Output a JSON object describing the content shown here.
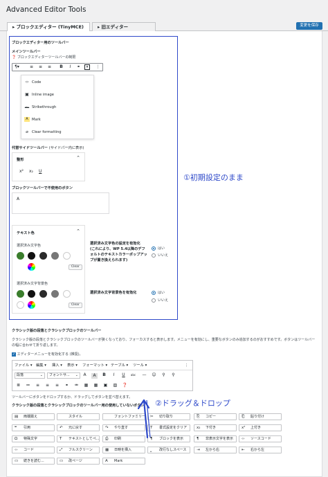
{
  "page_title": "Advanced Editor Tools",
  "save_button": "変更を保存",
  "tabs": [
    {
      "label": "ブロックエディター (TinyMCE)",
      "prefix": "▸"
    },
    {
      "label": "旧エディター (TinyMCE)",
      "prefix": "▸"
    }
  ],
  "block": {
    "section_title": "ブロックエディター用のツールバー",
    "main_toolbar_label": "メインツールバー",
    "main_toolbar_hint": "ブロックエディターツールバーの制限",
    "dropdown_items": [
      {
        "icon": "code-icon",
        "glyph": "‹›",
        "label": "Code"
      },
      {
        "icon": "image-icon",
        "glyph": "▣",
        "label": "Inline image"
      },
      {
        "icon": "strikethrough-icon",
        "glyph": "abc",
        "label": "Strikethrough"
      },
      {
        "icon": "mark-icon",
        "glyph": "A",
        "label": "Mark"
      },
      {
        "icon": "clear-format-icon",
        "glyph": "⌀",
        "label": "Clear formatting"
      }
    ],
    "side_toolbar_label": "代替サイドツールバー",
    "side_toolbar_note": "(サイドパー内に表示)",
    "format_panel_title": "整形",
    "format_icons": [
      "x²",
      "x₂",
      "U"
    ],
    "unused_label": "ブロックツールバーで不使用のボタン",
    "unused_box_value": "A",
    "text_color_panel_title": "テキスト色",
    "selected_text_color_label": "選択済み文字色",
    "selected_bg_color_label": "選択済み文字背景色",
    "clear_label": "Clear",
    "enable_text_color_label": "選択済み文字色の設定を有効化",
    "enable_text_color_desc": "(これにより、WP 5.4以降のデフォルトのテキストカラーポップアップが置き換えられます)",
    "enable_bg_color_label": "選択済み文字背景色を有効化",
    "yes": "はい",
    "no": "いいえ"
  },
  "annotation_1": "①初期設定のまま",
  "annotation_2": "②ドラッグ＆ドロップ",
  "classic": {
    "section_title": "クラシック版の段落とクラシックブロックのツールバー",
    "description": "クラシック版の段落とクラシックブロックのツールバーが狭くなっており、フォーカスすると表示します。メニューを有効にし、重要なボタンのみ追加するのがおすすめです。ボタンはツールバーの幅に合わせて折り返します。",
    "enable_menu_label": "エディターメニューを有効化する (推奨)。",
    "menu_items": [
      "ファイル ▾",
      "編集 ▾",
      "挿入 ▾",
      "表示 ▾",
      "フォーマット ▾",
      "テーブル ▾",
      "ツール ▾"
    ],
    "format_select": "段落",
    "font_select": "フォントサ...",
    "drag_hint": "ツールバーにボタンをドロップするか、ドラッグしてボタンを並べ替えます。",
    "unused_title": "クラシック版の段落とクラシックブロックのツールバー用の使用していないボタン",
    "unused_buttons": [
      {
        "icon": "paragraph-icon",
        "glyph": "▤",
        "label": "両端揃え"
      },
      {
        "icon": "style-icon",
        "glyph": "",
        "label": "スタイル"
      },
      {
        "icon": "font-family-icon",
        "glyph": "",
        "label": "フォントファミリー"
      },
      {
        "icon": "cut-icon",
        "glyph": "✂",
        "label": "切り取り"
      },
      {
        "icon": "copy-icon",
        "glyph": "⎘",
        "label": "コピー"
      },
      {
        "icon": "paste-icon",
        "glyph": "⎗",
        "label": "貼り付け"
      },
      {
        "icon": "quote-icon",
        "glyph": "❝",
        "label": "引用"
      },
      {
        "icon": "undo-icon",
        "glyph": "↶",
        "label": "元に戻す"
      },
      {
        "icon": "redo-icon",
        "glyph": "↷",
        "label": "やり直す"
      },
      {
        "icon": "clear-format-icon",
        "glyph": "T",
        "label": "書式設定をクリア"
      },
      {
        "icon": "subscript-icon",
        "glyph": "x₂",
        "label": "下付き"
      },
      {
        "icon": "superscript-icon",
        "glyph": "x²",
        "label": "上付き"
      },
      {
        "icon": "special-char-icon",
        "glyph": "Ω",
        "label": "特殊文字"
      },
      {
        "icon": "paste-text-icon",
        "glyph": "T",
        "label": "テキストとしてペ..."
      },
      {
        "icon": "print-icon",
        "glyph": "⎙",
        "label": "印刷"
      },
      {
        "icon": "show-blocks-icon",
        "glyph": "¶",
        "label": "ブロックを表示"
      },
      {
        "icon": "invisible-chars-icon",
        "glyph": "¶",
        "label": "非表示文字を表示"
      },
      {
        "icon": "source-code-icon",
        "glyph": "‹›",
        "label": "ソースコード"
      },
      {
        "icon": "code-icon",
        "glyph": "‹›",
        "label": "コード"
      },
      {
        "icon": "fullscreen-icon",
        "glyph": "⤢",
        "label": "フルスクリーン"
      },
      {
        "icon": "date-icon",
        "glyph": "▦",
        "label": "日時を挿入"
      },
      {
        "icon": "nonbreaking-space-icon",
        "glyph": "⎵",
        "label": "改行なしスペース"
      },
      {
        "icon": "ltr-icon",
        "glyph": "⇥",
        "label": "左から右"
      },
      {
        "icon": "rtl-icon",
        "glyph": "⇤",
        "label": "右から左"
      },
      {
        "icon": "read-more-icon",
        "glyph": "▭",
        "label": "続きを読む..."
      },
      {
        "icon": "page-break-icon",
        "glyph": "▭",
        "label": "改ページ"
      },
      {
        "icon": "mark-icon",
        "glyph": "A",
        "label": "Mark"
      }
    ]
  },
  "colors": {
    "accent": "#2271b1",
    "annotation": "#2d48c9",
    "swatch_green": "#3a7d2c",
    "swatch_black1": "#111111",
    "swatch_black2": "#2a2a2a",
    "swatch_gray": "#777777",
    "swatch_white": "#ffffff"
  }
}
